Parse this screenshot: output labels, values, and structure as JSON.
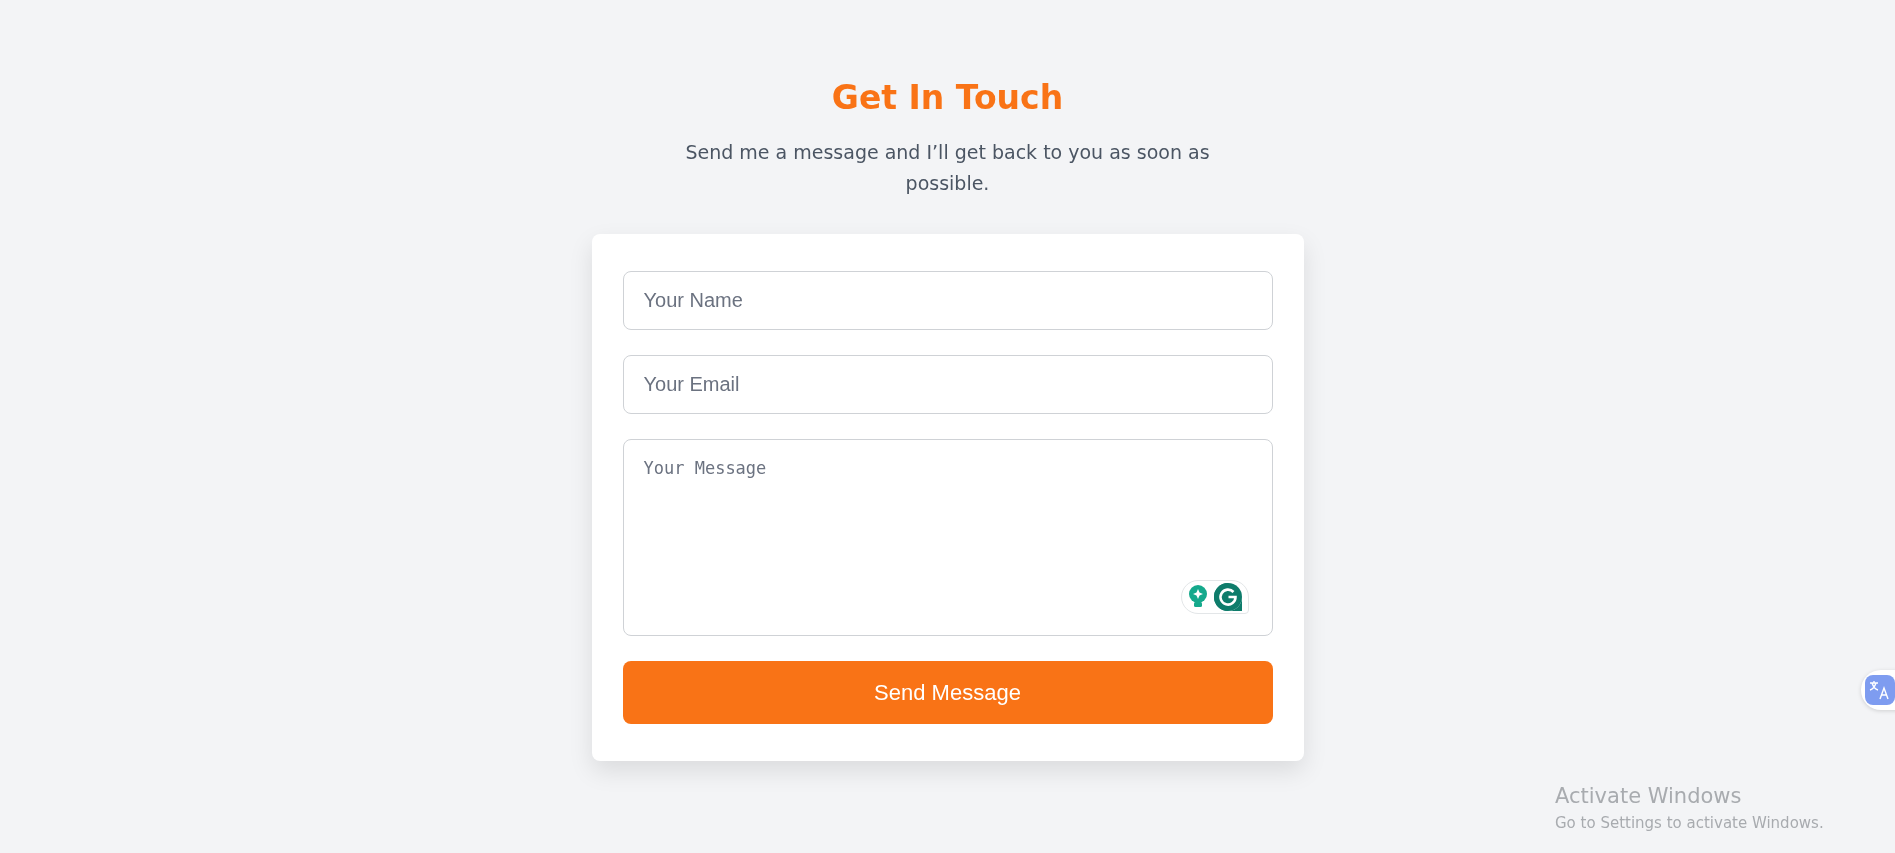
{
  "header": {
    "title": "Get In Touch",
    "subtitle": "Send me a message and I’ll get back to you as soon as possible."
  },
  "form": {
    "fields": [
      {
        "kind": "input",
        "placeholder": "Your Name"
      },
      {
        "kind": "input",
        "placeholder": "Your Email"
      },
      {
        "kind": "textarea",
        "placeholder": "Your Message"
      }
    ],
    "submit": "Send Message"
  },
  "os_notice": {
    "title": "Activate Windows",
    "text": "Go to Settings to activate Windows."
  }
}
